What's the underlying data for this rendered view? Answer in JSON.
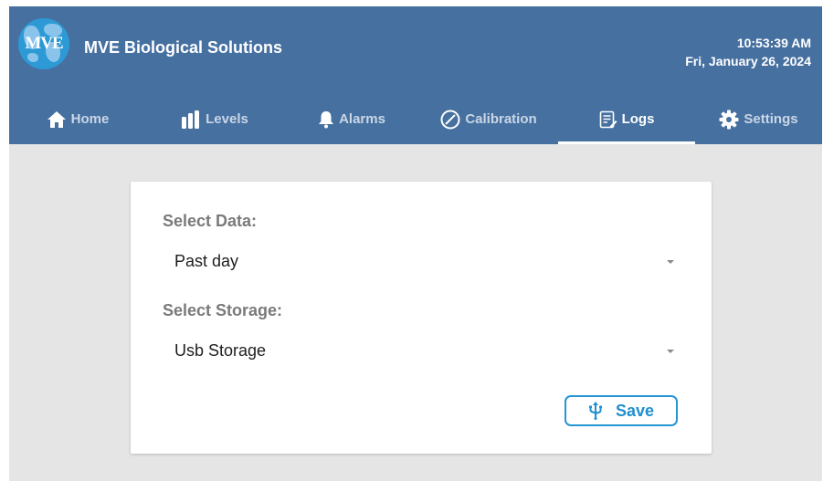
{
  "app": {
    "logo_text": "MVE",
    "title": "MVE Biological Solutions",
    "time": "10:53:39 AM",
    "date": "Fri, January 26, 2024"
  },
  "tabs": [
    {
      "label": "Home",
      "icon": "home-icon",
      "active": false
    },
    {
      "label": "Levels",
      "icon": "levels-bars-icon",
      "active": false
    },
    {
      "label": "Alarms",
      "icon": "bell-icon",
      "active": false
    },
    {
      "label": "Calibration",
      "icon": "compass-icon",
      "active": false
    },
    {
      "label": "Logs",
      "icon": "log-document-icon",
      "active": true
    },
    {
      "label": "Settings",
      "icon": "gear-icon",
      "active": false
    }
  ],
  "form": {
    "data_label": "Select Data:",
    "data_value": "Past day",
    "storage_label": "Select Storage:",
    "storage_value": "Usb Storage",
    "save_label": "Save",
    "save_icon": "usb-icon"
  },
  "colors": {
    "header": "#4670a0",
    "accent": "#2596d4",
    "background": "#e5e5e5"
  }
}
